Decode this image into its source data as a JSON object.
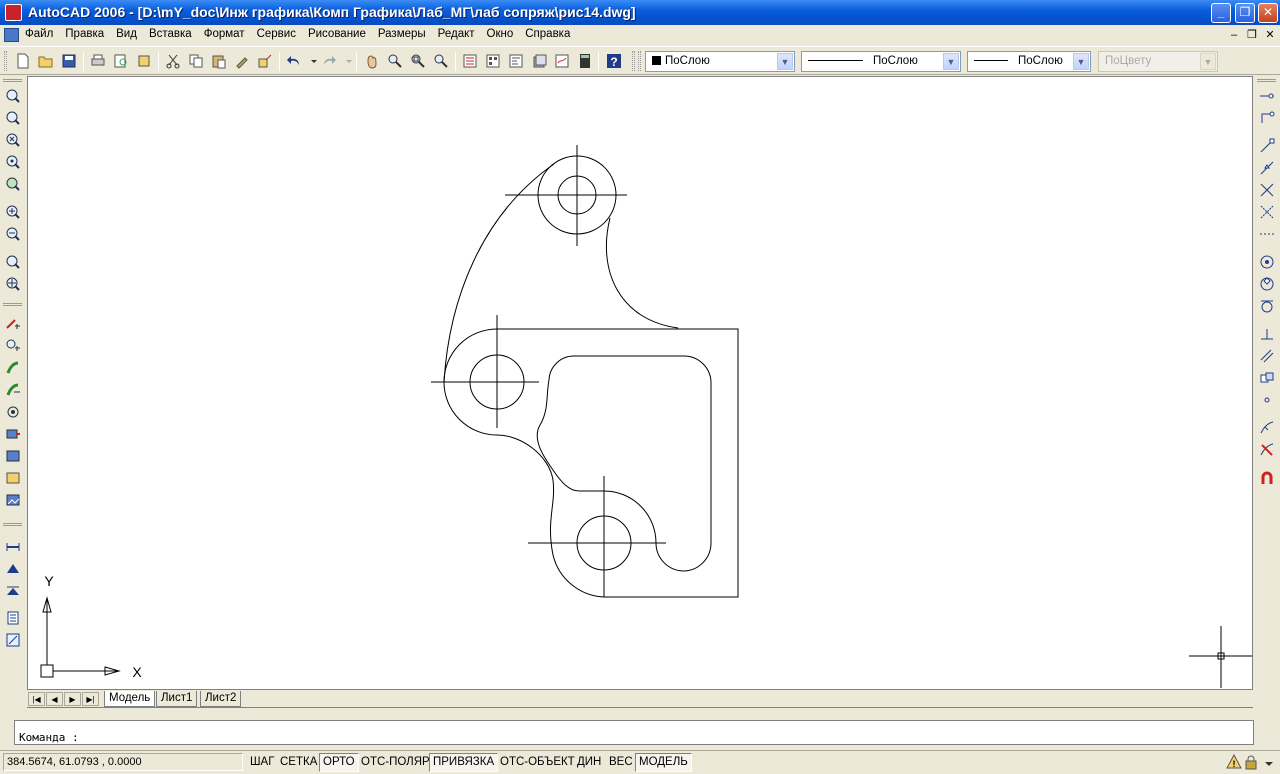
{
  "window": {
    "title": "AutoCAD 2006 - [D:\\mY_doc\\Инж графика\\Комп Графика\\Лаб_МГ\\лаб сопряж\\рис14.dwg]",
    "minimize": "_",
    "maximize": "❐",
    "close": "✕"
  },
  "menu": {
    "items": [
      "Файл",
      "Правка",
      "Вид",
      "Вставка",
      "Формат",
      "Сервис",
      "Рисование",
      "Размеры",
      "Редакт",
      "Окно",
      "Справка"
    ]
  },
  "toolbar": {
    "color_value": "ПоСлою",
    "linetype_value": "ПоСлою",
    "lineweight_value": "ПоСлою",
    "plotstyle_value": "ПоЦвету",
    "icons": [
      "new-icon",
      "open-icon",
      "save-icon",
      "print-icon",
      "print-preview-icon",
      "publish-icon",
      "cut-icon",
      "copy-icon",
      "paste-icon",
      "match-properties-icon",
      "block-editor-icon",
      "undo-icon",
      "redo-icon",
      "pan-icon",
      "zoom-realtime-icon",
      "zoom-window-icon",
      "zoom-previous-icon",
      "properties-icon",
      "design-center-icon",
      "tool-palettes-icon",
      "sheet-set-icon",
      "markup-icon",
      "quick-calc-icon",
      "help-icon"
    ]
  },
  "ucs": {
    "x_label": "X",
    "y_label": "Y"
  },
  "tabs": {
    "items": [
      "Модель",
      "Лист1",
      "Лист2"
    ],
    "active": "Модель"
  },
  "command": {
    "prompt": "Команда :"
  },
  "status": {
    "coords": "384.5674, 61.0793 , 0.0000",
    "buttons": [
      {
        "label": "ШАГ",
        "on": false
      },
      {
        "label": "СЕТКА",
        "on": false
      },
      {
        "label": "ОРТО",
        "on": true
      },
      {
        "label": "ОТС-ПОЛЯР",
        "on": false
      },
      {
        "label": "ПРИВЯЗКА",
        "on": true
      },
      {
        "label": "ОТС-ОБЪЕКТ",
        "on": false
      },
      {
        "label": "ДИН",
        "on": false
      },
      {
        "label": "ВЕС",
        "on": false
      },
      {
        "label": "МОДЕЛЬ",
        "on": true
      }
    ]
  },
  "colors": {
    "titlebar": "#0453d0",
    "chrome": "#ece9d8",
    "canvas": "#ffffff",
    "drawing_lines": "#000000"
  }
}
